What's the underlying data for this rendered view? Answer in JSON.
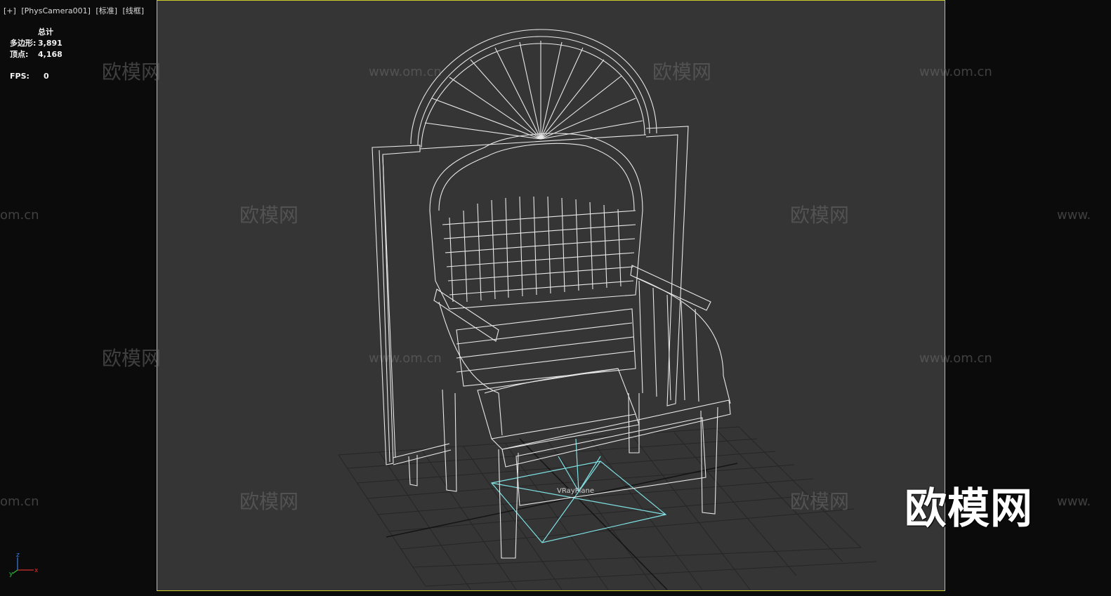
{
  "viewport": {
    "plus": "[+]",
    "camera": "[PhysCamera001]",
    "mode": "[标准]",
    "shading": "[线框]"
  },
  "stats": {
    "header": "总计",
    "polys_label": "多边形:",
    "polys_value": "3,891",
    "verts_label": "顶点:",
    "verts_value": "4,168",
    "fps_label": "FPS:",
    "fps_value": "0"
  },
  "scene": {
    "object_label": "VRayPlane"
  },
  "watermarks": {
    "cn": "欧模网",
    "url": "www.om.cn",
    "url_partial": "om.cn",
    "url_prefix": "www.",
    "big": "欧模网"
  },
  "colors": {
    "frame": "#cfcc2d",
    "wire": "#e8e8e8",
    "grid": "#1d1d1d",
    "vray": "#7fe1e3",
    "axis_x": "#d83030",
    "axis_y": "#2fbf3a",
    "axis_z": "#3a7fe6"
  }
}
